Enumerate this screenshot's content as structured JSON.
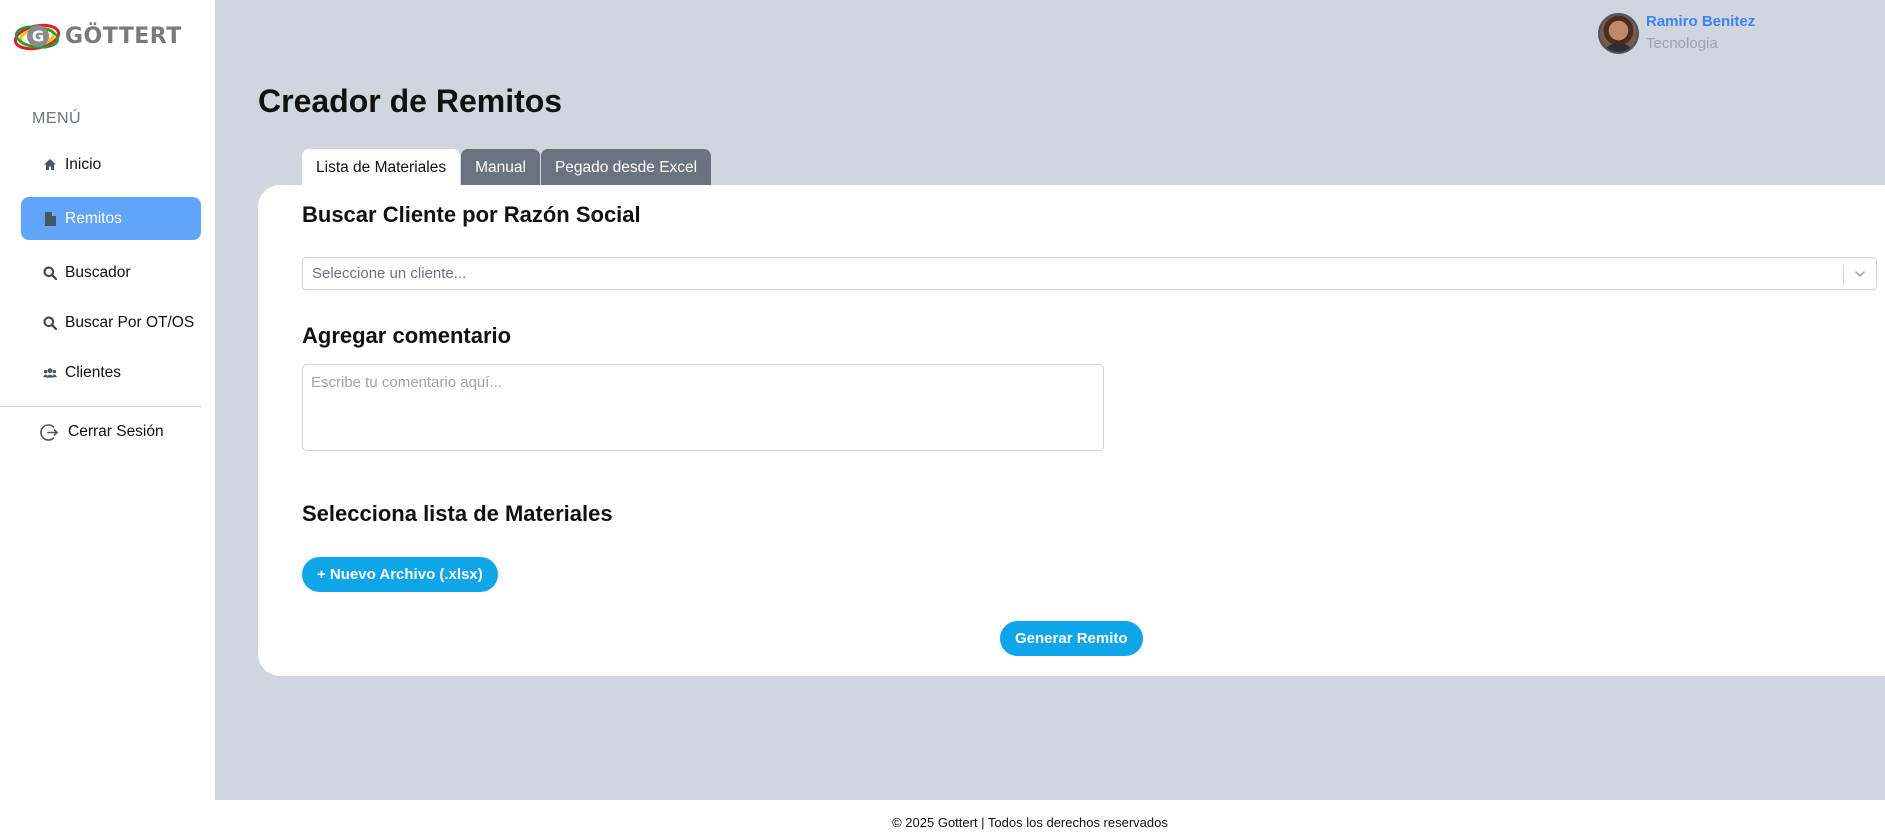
{
  "brand": {
    "name": "GÖTTERT"
  },
  "sidebar": {
    "menu_title": "MENÚ",
    "items": [
      {
        "label": "Inicio",
        "icon": "home-icon"
      },
      {
        "label": "Remitos",
        "icon": "file-icon",
        "active": true
      },
      {
        "label": "Buscador",
        "icon": "search-icon"
      },
      {
        "label": "Buscar Por OT/OS",
        "icon": "search-icon"
      },
      {
        "label": "Clientes",
        "icon": "users-icon"
      }
    ],
    "logout_label": "Cerrar Sesión"
  },
  "user": {
    "name": "Ramiro Benitez",
    "role": "Tecnologia"
  },
  "page": {
    "title": "Creador de Remitos"
  },
  "tabs": [
    {
      "label": "Lista de Materiales",
      "active": true
    },
    {
      "label": "Manual"
    },
    {
      "label": "Pegado desde Excel"
    }
  ],
  "form": {
    "client_heading": "Buscar Cliente por Razón Social",
    "client_placeholder": "Seleccione un cliente...",
    "comment_heading": "Agregar comentario",
    "comment_placeholder": "Escribe tu comentario aquí...",
    "materials_heading": "Selecciona lista de Materiales",
    "new_file_label": "+ Nuevo Archivo (.xlsx)",
    "generate_label": "Generar Remito"
  },
  "footer": {
    "text": "© 2025 Gottert | Todos los derechos reservados"
  },
  "colors": {
    "accent": "#0ea5e9",
    "active_nav": "#60a5fa",
    "main_bg": "#d1d5de",
    "tab_inactive": "#6b7280",
    "user_name": "#3b82f6"
  }
}
